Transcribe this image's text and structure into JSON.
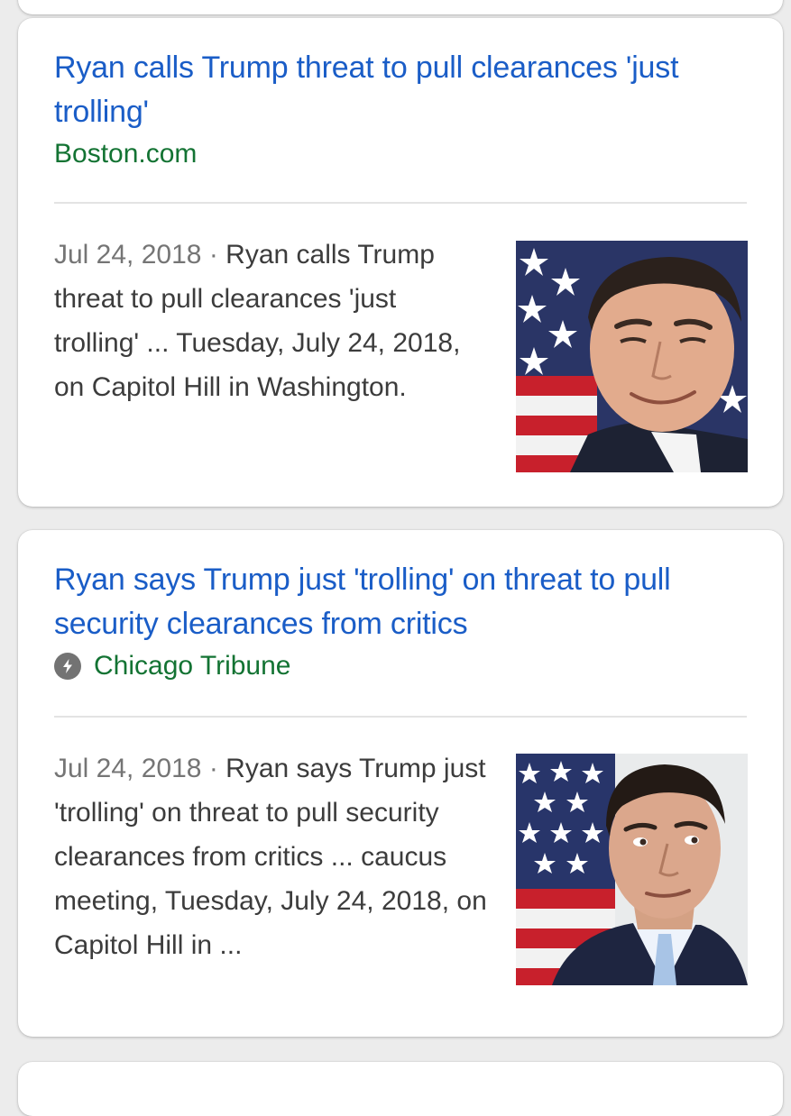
{
  "results": [
    {
      "headline": "Ryan calls Trump threat to pull clearances 'just trolling'",
      "source": "Boston.com",
      "date": "Jul 24, 2018",
      "separator": "·",
      "snippet": "Ryan calls Trump threat to pull clearances 'just trolling' ... Tuesday, July 24, 2018, on Capitol Hill in Washington.",
      "thumbnail": "Paul Ryan smiling in front of an American flag"
    },
    {
      "headline": "Ryan says Trump just 'trolling' on threat to pull security clearances from critics",
      "source": "Chicago Tribune",
      "source_icon": "amp-lightning-icon",
      "date": "Jul 24, 2018",
      "separator": "·",
      "snippet": "Ryan says Trump just 'trolling' on threat to pull security clearances from critics ... caucus meeting, Tuesday, July 24, 2018, on Capitol Hill in ...",
      "thumbnail": "Paul Ryan in suit and tie in front of an American flag"
    }
  ],
  "colors": {
    "headline": "#1a5dc7",
    "source": "#137333",
    "snippet": "#3c3c3c",
    "date": "#757575",
    "background": "#ececec",
    "card": "#ffffff"
  }
}
